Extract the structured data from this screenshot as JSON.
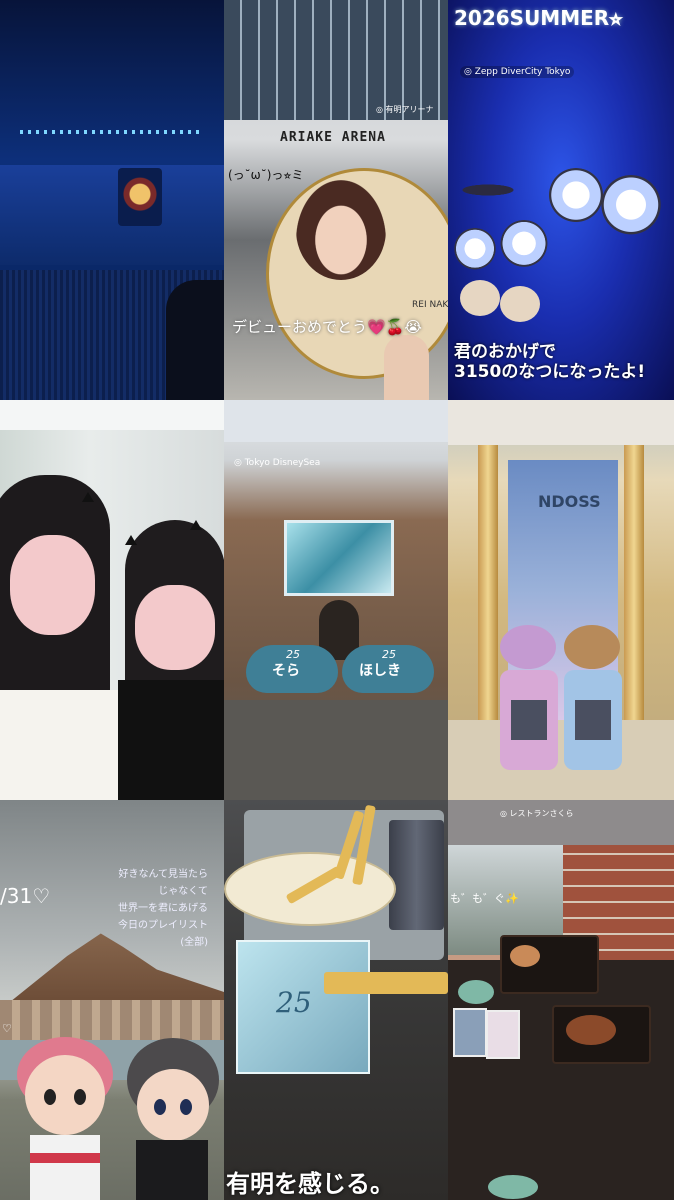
{
  "tiles": {
    "arena": {},
    "ariake": {
      "building_sign": "ARIAKE ARENA",
      "location": "◎ 有明アリーナ",
      "emoticon": "(っ˘ω˘)っ⭐︎ミ",
      "fan_name": "REI NAKAM",
      "caption": "デビューおめでとう💗🍒😭"
    },
    "zepp": {
      "title": "2026SUMMER⭐︎",
      "location": "◎ Zepp DiverCity Tokyo",
      "caption_line1": "君のおかげで",
      "caption_line2": "3150のなつになったよ!"
    },
    "selfie": {},
    "disneysea": {
      "location": "◎ Tokyo DisneySea",
      "card_left_num": "25",
      "card_left_name": "そら",
      "card_right_num": "25",
      "card_right_name": "ほしき"
    },
    "duffy": {
      "display_sign": "NDOSS"
    },
    "volcano": {
      "date": "/31♡",
      "lyrics": [
        "好きなんて見当たら",
        "じゃなくて",
        "世界一を君にあげる",
        "今日のプレイリスト",
        "(全部)"
      ],
      "heart": "♡"
    },
    "fries": {
      "box_label": "25",
      "caption": "有明を感じる。"
    },
    "restaurant": {
      "location": "◎ レストランさくら",
      "mogu": "も゛も゛ぐ✨"
    }
  },
  "colors": {
    "arena_blue": "#0d2f7a",
    "zepp_blue": "#1a2eb0",
    "disney_card": "#3f7f96"
  }
}
